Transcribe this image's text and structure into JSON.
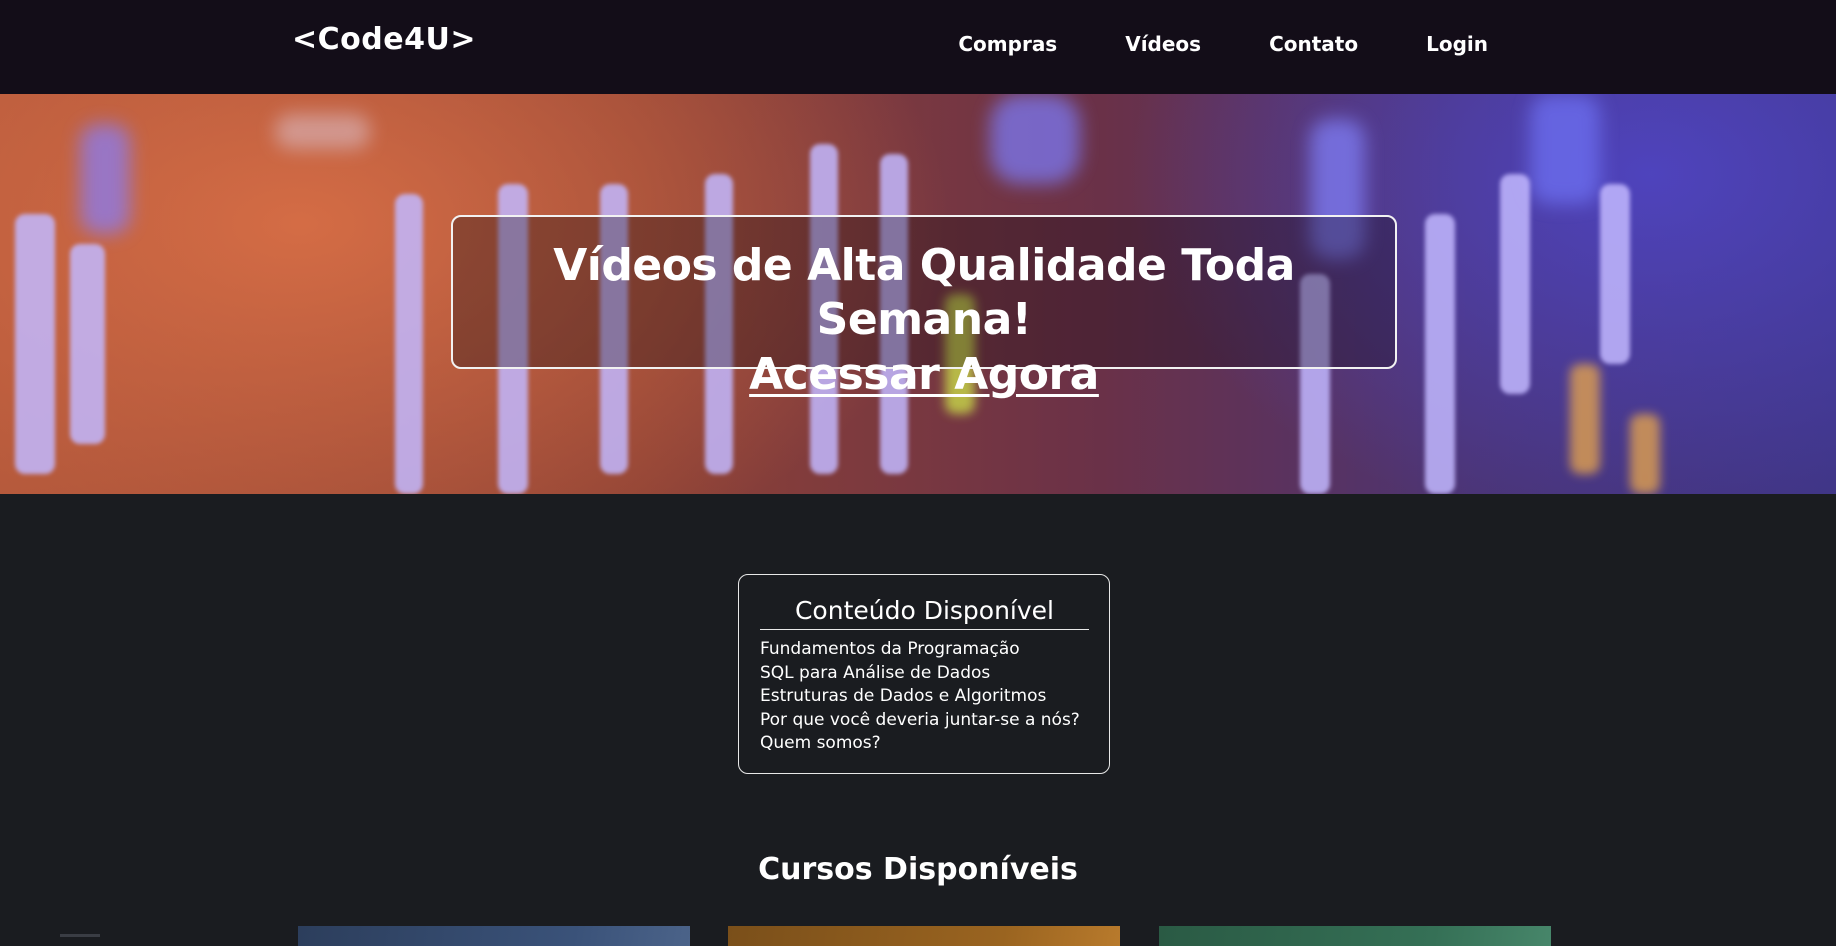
{
  "header": {
    "logo": "<Code4U>",
    "nav": [
      "Compras",
      "Vídeos",
      "Contato",
      "Login"
    ]
  },
  "hero": {
    "title": "Vídeos de Alta Qualidade Toda Semana!",
    "cta": "Acessar Agora"
  },
  "content_panel": {
    "title": "Conteúdo Disponível",
    "items": [
      "Fundamentos da Programação",
      "SQL para Análise de Dados",
      "Estruturas de Dados e Algoritmos",
      "Por que você deveria juntar-se a nós?",
      "Quem somos?"
    ]
  },
  "courses": {
    "title": "Cursos Disponíveis"
  },
  "colors": {
    "header_bg": "#130d18",
    "page_bg": "#1a1c20",
    "text": "#ffffff"
  }
}
